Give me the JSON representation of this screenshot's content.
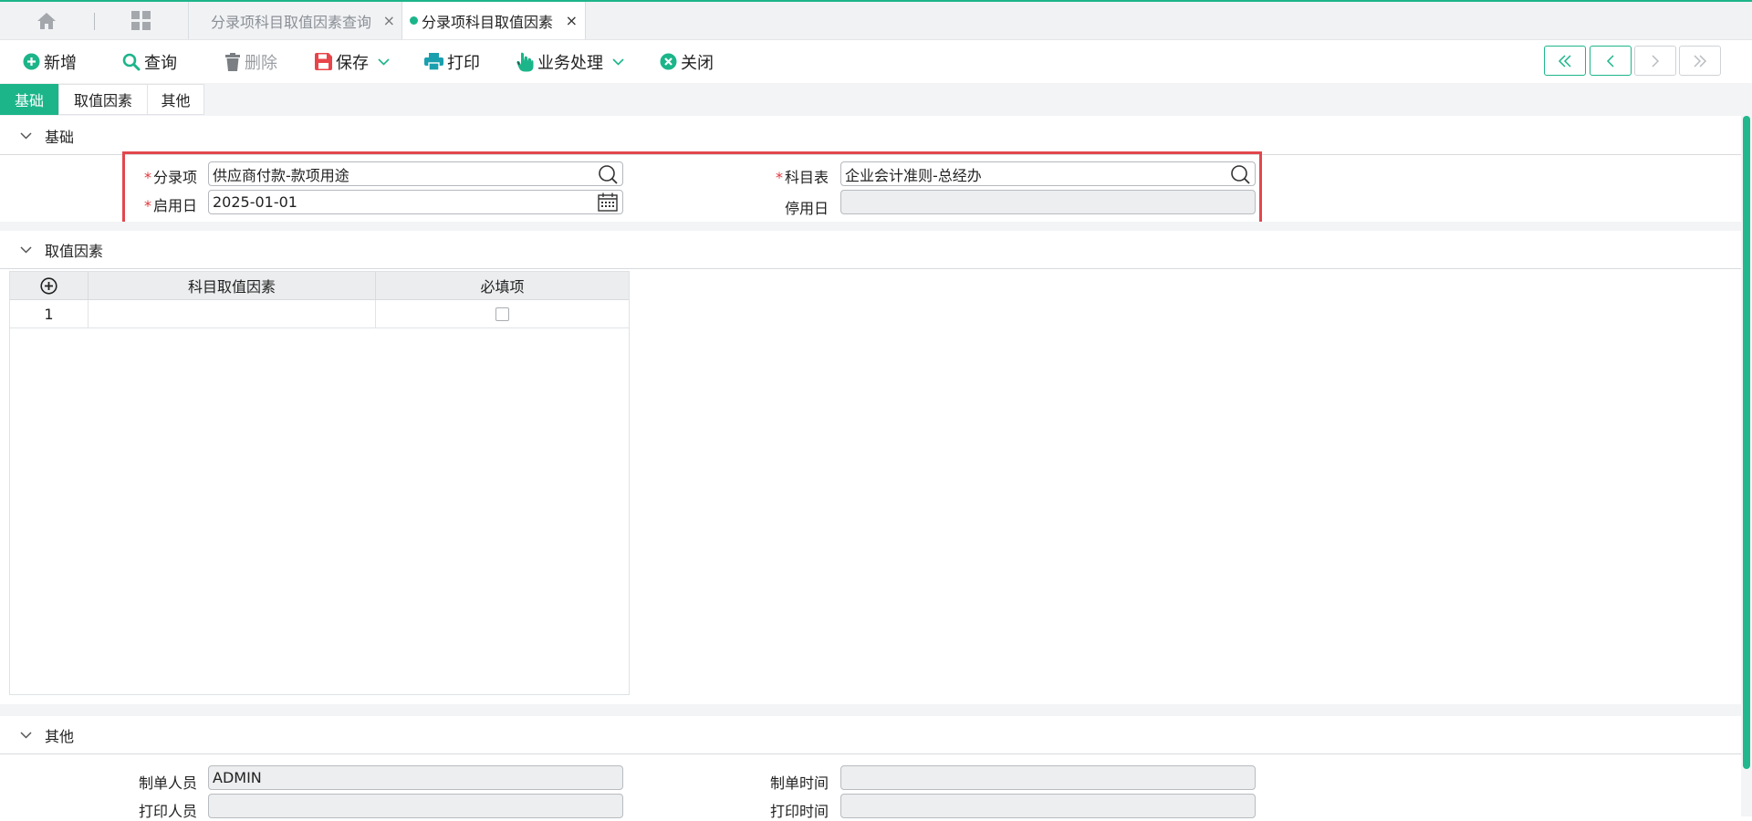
{
  "tabbar": {
    "tabs": [
      {
        "label": "分录项科目取值因素查询",
        "active": false
      },
      {
        "label": "分录项科目取值因素",
        "active": true
      }
    ],
    "close_glyph": "×"
  },
  "toolbar": {
    "add": "新增",
    "query": "查询",
    "delete": "删除",
    "save": "保存",
    "print": "打印",
    "business": "业务处理",
    "close": "关闭"
  },
  "form_tabs": [
    "基础",
    "取值因素",
    "其他"
  ],
  "sections": {
    "basic": {
      "title": "基础",
      "entry_item_label": "分录项",
      "entry_item_value": "供应商付款-款项用途",
      "chart_label": "科目表",
      "chart_value": "企业会计准则-总经办",
      "start_date_label": "启用日",
      "start_date_value": "2025-01-01",
      "stop_date_label": "停用日",
      "stop_date_value": ""
    },
    "factors": {
      "title": "取值因素",
      "columns": [
        "科目取值因素",
        "必填项"
      ],
      "rows": [
        {
          "no": "1",
          "factor": "",
          "required": false
        }
      ]
    },
    "other": {
      "title": "其他",
      "creator_label": "制单人员",
      "creator_value": "ADMIN",
      "created_time_label": "制单时间",
      "created_time_value": "",
      "printer_label": "打印人员",
      "printer_value": "",
      "print_time_label": "打印时间",
      "print_time_value": ""
    }
  },
  "colors": {
    "accent": "#1cb58a",
    "required": "#e0383e",
    "highlight_box": "#e2474d"
  }
}
